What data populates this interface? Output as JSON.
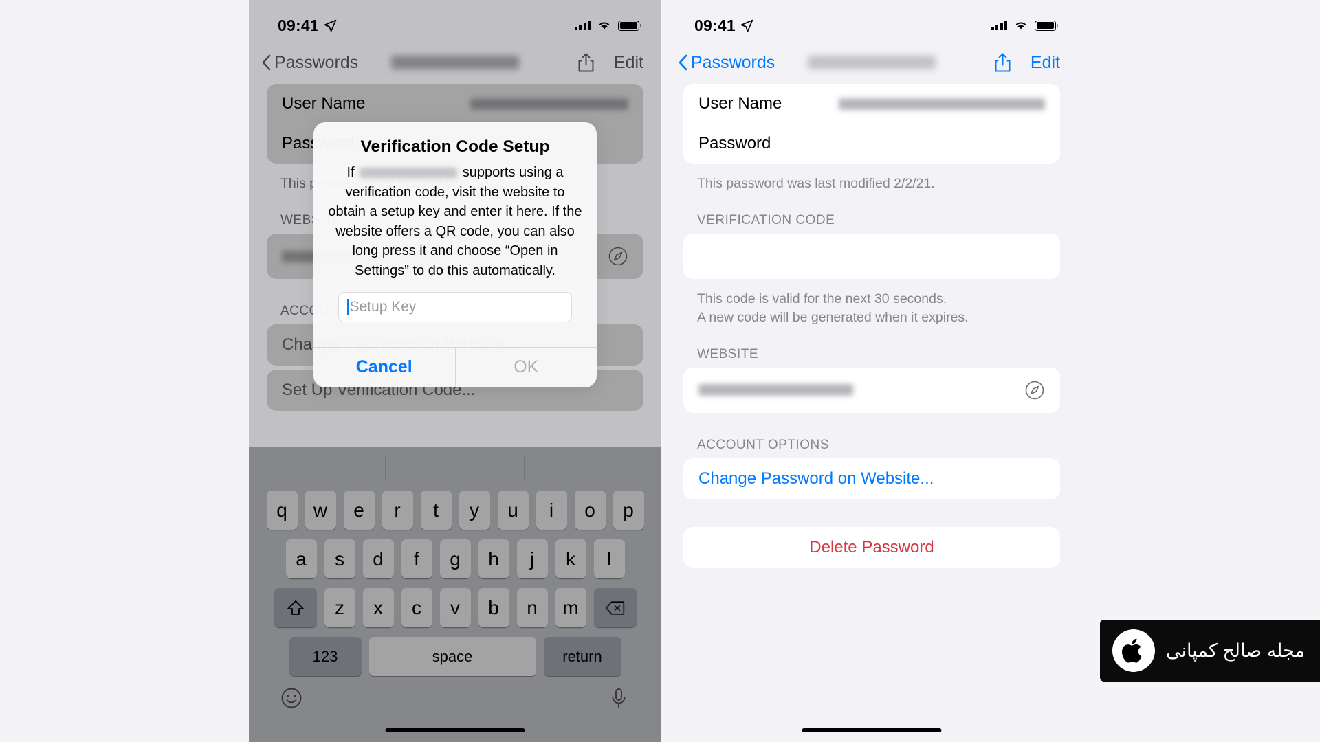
{
  "meta": {
    "accent_blue": "#007aff",
    "danger_red": "#d7373f",
    "page_bg": "#f2f2f7"
  },
  "status_bar": {
    "time": "09:41",
    "location_icon": "location-arrow-icon",
    "cellular_icon": "cellular-bars-icon",
    "wifi_icon": "wifi-icon",
    "battery_icon": "battery-icon"
  },
  "nav": {
    "back_label": "Passwords",
    "back_icon": "chevron-left-icon",
    "share_icon": "share-icon",
    "edit_label": "Edit",
    "title_redacted": true
  },
  "detail": {
    "credentials": [
      {
        "label": "User Name",
        "value_redacted": true
      },
      {
        "label": "Password",
        "value_redacted": false
      }
    ],
    "modified_note": "This password was last modified 2/2/21.",
    "verification_section_header": "VERIFICATION CODE",
    "verification_note_line1": "This code is valid for the next 30 seconds.",
    "verification_note_line2": "A new code will be generated when it expires.",
    "website_section_header": "WEBSITE",
    "website_value_redacted": true,
    "website_open_icon": "safari-compass-icon",
    "account_options_header": "ACCOUNT OPTIONS",
    "change_password_label": "Change Password on Website...",
    "delete_password_label": "Delete Password",
    "setup_verification_label": "Set Up Verification Code..."
  },
  "alert": {
    "title": "Verification Code Setup",
    "message_part1": "If",
    "message_redacted_site": true,
    "message_part2": "supports using a verification code, visit the website to obtain a setup key and enter it here. If the website offers a QR code, you can also long press it and choose “Open in Settings” to do this automatically.",
    "input_placeholder": "Setup Key",
    "input_value": "",
    "cancel_label": "Cancel",
    "ok_label": "OK",
    "ok_disabled": true
  },
  "keyboard": {
    "row1": [
      "q",
      "w",
      "e",
      "r",
      "t",
      "y",
      "u",
      "i",
      "o",
      "p"
    ],
    "row2": [
      "a",
      "s",
      "d",
      "f",
      "g",
      "h",
      "j",
      "k",
      "l"
    ],
    "row3": [
      "z",
      "x",
      "c",
      "v",
      "b",
      "n",
      "m"
    ],
    "shift_icon": "shift-arrow-icon",
    "delete_icon": "backspace-delete-icon",
    "numbers_label": "123",
    "space_label": "space",
    "return_label": "return",
    "emoji_icon": "emoji-smiley-icon",
    "dictation_icon": "microphone-icon"
  },
  "watermark": {
    "brand_icon": "apple-logo-icon",
    "text": "مجله صالح کمپانی"
  }
}
